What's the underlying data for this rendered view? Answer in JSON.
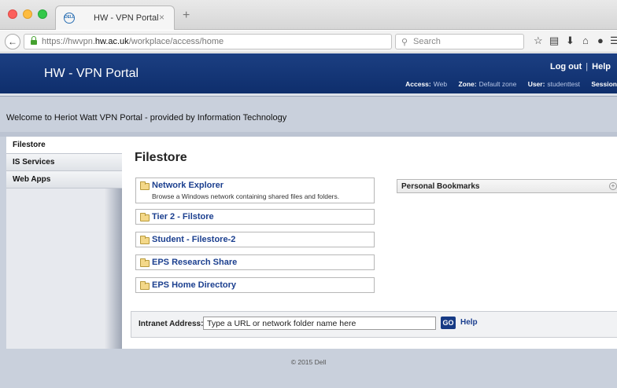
{
  "browser": {
    "tab_title": "HW - VPN Portal",
    "tab_favicon_text": "DELL",
    "tab_close": "×",
    "new_tab": "+",
    "url_prefix": "https://hwvpn.",
    "url_domain": "hw.ac.uk",
    "url_path": "/workplace/access/home",
    "search_placeholder": "Search",
    "icons": [
      "back-arrow-icon",
      "lock-icon",
      "reload-icon",
      "search-icon",
      "star-icon",
      "reader-list-icon",
      "download-icon",
      "home-icon",
      "chat-icon",
      "menu-icon"
    ]
  },
  "header": {
    "title": "HW - VPN Portal",
    "logout": "Log out",
    "separator": "|",
    "help": "Help",
    "access_label": "Access:",
    "access_value": "Web",
    "zone_label": "Zone:",
    "zone_value": "Default zone",
    "user_label": "User:",
    "user_value": "studenttest",
    "session_label": "Session"
  },
  "welcome": "Welcome to Heriot Watt VPN Portal - provided by Information Technology",
  "sidebar": {
    "items": [
      {
        "label": "Filestore",
        "active": true
      },
      {
        "label": "IS Services",
        "active": false
      },
      {
        "label": "Web Apps",
        "active": false
      }
    ]
  },
  "main": {
    "title": "Filestore",
    "items": [
      {
        "label": "Network Explorer",
        "description": "Browse a Windows network containing shared files and folders."
      },
      {
        "label": "Tier 2 - Filstore"
      },
      {
        "label": "Student - Filestore-2"
      },
      {
        "label": "EPS Research Share"
      },
      {
        "label": "EPS Home Directory"
      }
    ],
    "bookmarks_title": "Personal Bookmarks",
    "intranet_label": "Intranet Address:",
    "intranet_placeholder": "Type a URL or network folder name here",
    "go_label": "GO",
    "help_label": "Help"
  },
  "footer": "© 2015 Dell",
  "colors": {
    "header_bg": "#15367a",
    "link": "#1b3f8f",
    "page_bg": "#c9d0dc"
  }
}
